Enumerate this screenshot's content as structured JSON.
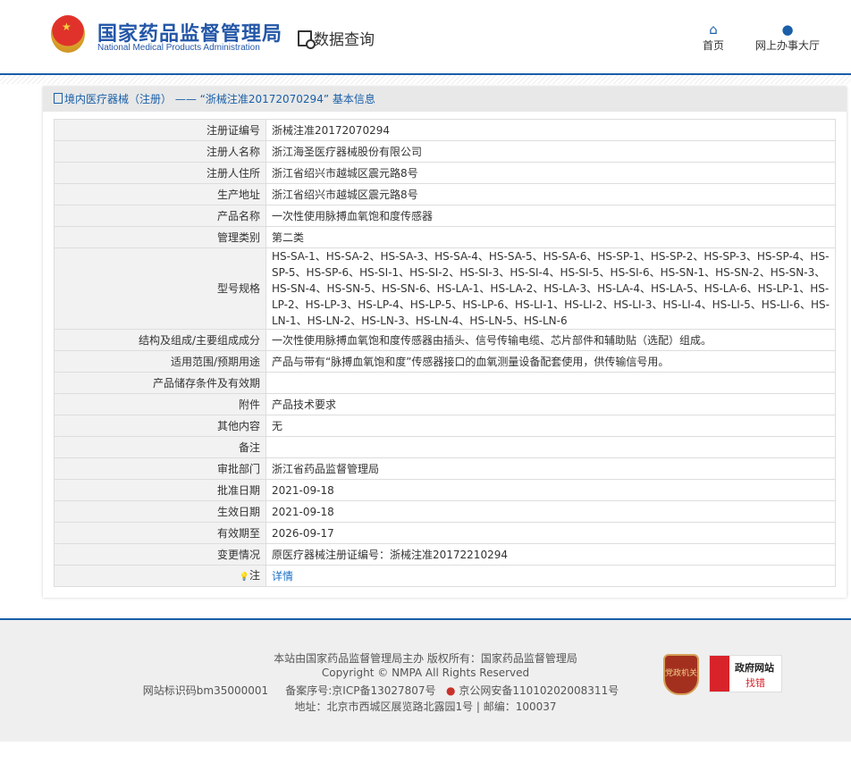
{
  "header": {
    "logo_cn": "国家药品监督管理局",
    "logo_en": "National Medical Products Administration",
    "section": "数据查询",
    "nav": [
      {
        "label": "首页",
        "icon": "home-icon"
      },
      {
        "label": "网上办事大厅",
        "icon": "user-icon"
      }
    ]
  },
  "panel": {
    "title": "境内医疗器械（注册） —— “浙械注准20172070294” 基本信息"
  },
  "rows": [
    {
      "label": "注册证编号",
      "value": "浙械注准20172070294"
    },
    {
      "label": "注册人名称",
      "value": "浙江海圣医疗器械股份有限公司"
    },
    {
      "label": "注册人住所",
      "value": "浙江省绍兴市越城区震元路8号"
    },
    {
      "label": "生产地址",
      "value": "浙江省绍兴市越城区震元路8号"
    },
    {
      "label": "产品名称",
      "value": "一次性使用脉搏血氧饱和度传感器"
    },
    {
      "label": "管理类别",
      "value": "第二类"
    },
    {
      "label": "型号规格",
      "value": "HS-SA-1、HS-SA-2、HS-SA-3、HS-SA-4、HS-SA-5、HS-SA-6、HS-SP-1、HS-SP-2、HS-SP-3、HS-SP-4、HS-SP-5、HS-SP-6、HS-SI-1、HS-SI-2、HS-SI-3、HS-SI-4、HS-SI-5、HS-SI-6、HS-SN-1、HS-SN-2、HS-SN-3、HS-SN-4、HS-SN-5、HS-SN-6、HS-LA-1、HS-LA-2、HS-LA-3、HS-LA-4、HS-LA-5、HS-LA-6、HS-LP-1、HS-LP-2、HS-LP-3、HS-LP-4、HS-LP-5、HS-LP-6、HS-LI-1、HS-LI-2、HS-LI-3、HS-LI-4、HS-LI-5、HS-LI-6、HS-LN-1、HS-LN-2、HS-LN-3、HS-LN-4、HS-LN-5、HS-LN-6"
    },
    {
      "label": "结构及组成/主要组成成分",
      "value": "一次性使用脉搏血氧饱和度传感器由插头、信号传输电缆、芯片部件和辅助贴（选配）组成。"
    },
    {
      "label": "适用范围/预期用途",
      "value": "产品与带有“脉搏血氧饱和度”传感器接口的血氧测量设备配套使用，供传输信号用。"
    },
    {
      "label": "产品储存条件及有效期",
      "value": ""
    },
    {
      "label": "附件",
      "value": "产品技术要求"
    },
    {
      "label": "其他内容",
      "value": "无"
    },
    {
      "label": "备注",
      "value": ""
    },
    {
      "label": "审批部门",
      "value": "浙江省药品监督管理局"
    },
    {
      "label": "批准日期",
      "value": "2021-09-18"
    },
    {
      "label": "生效日期",
      "value": "2021-09-18"
    },
    {
      "label": "有效期至",
      "value": "2026-09-17"
    },
    {
      "label": "变更情况",
      "value": "原医疗器械注册证编号：浙械注准20172210294"
    },
    {
      "label": "注",
      "value": "详情",
      "link": true
    }
  ],
  "footer": {
    "line1": "本站由国家药品监督管理局主办 版权所有：国家药品监督管理局",
    "line2": "Copyright © NMPA All Rights Reserved",
    "site_code": "网站标识码bm35000001",
    "icp": "备案序号:京ICP备13027807号",
    "police": "京公网安备11010202008311号",
    "line4": "地址：北京市西城区展览路北露园1号 | 邮编：100037",
    "badge1": "党政机关",
    "badge2_line1": "政府网站",
    "badge2_line2": "找错"
  },
  "colors": {
    "brand": "#1a5fa8",
    "link": "#1a70c8"
  }
}
